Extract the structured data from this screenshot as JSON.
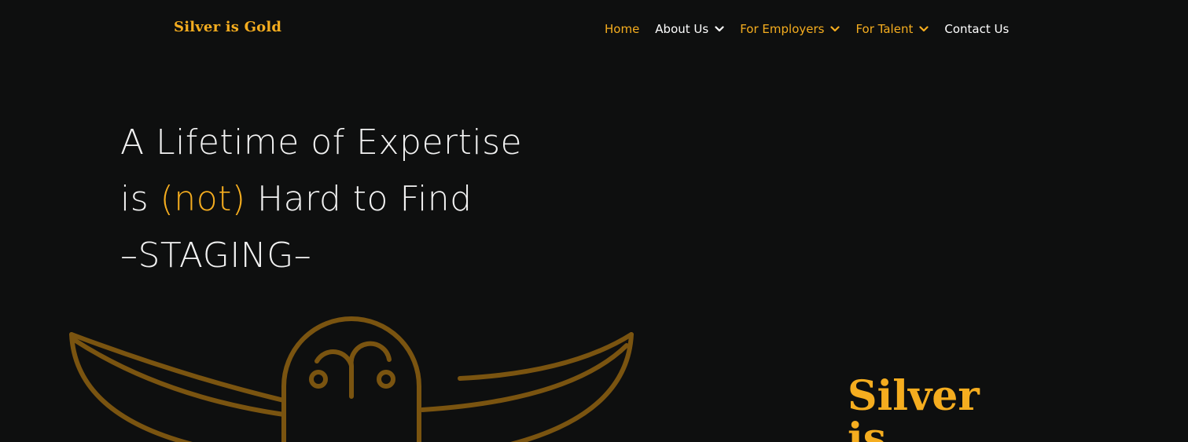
{
  "brand": {
    "logo_text": "Silver is Gold"
  },
  "nav": {
    "items": [
      {
        "label": "Home",
        "has_dropdown": false,
        "color": "#f5ad1f"
      },
      {
        "label": "About Us",
        "has_dropdown": true,
        "color": "#ffffff"
      },
      {
        "label": "For Employers",
        "has_dropdown": true,
        "color": "#f5ad1f"
      },
      {
        "label": "For Talent",
        "has_dropdown": true,
        "color": "#f5ad1f"
      },
      {
        "label": "Contact Us",
        "has_dropdown": false,
        "color": "#ffffff"
      }
    ]
  },
  "hero": {
    "line1": "A Lifetime of Expertise",
    "line2_prefix": "is ",
    "line2_accent": "(not)",
    "line2_suffix": " Hard to Find",
    "line3": "–STAGING–"
  },
  "side": {
    "word1": "Silver",
    "word2": "is"
  },
  "colors": {
    "background": "#0e0f0f",
    "accent": "#f5ad1f",
    "owl_stroke": "#7a5410",
    "text": "#f2f2f2"
  },
  "icons": {
    "logo_illustration": "owl-icon",
    "dropdown": "chevron-down-icon"
  }
}
